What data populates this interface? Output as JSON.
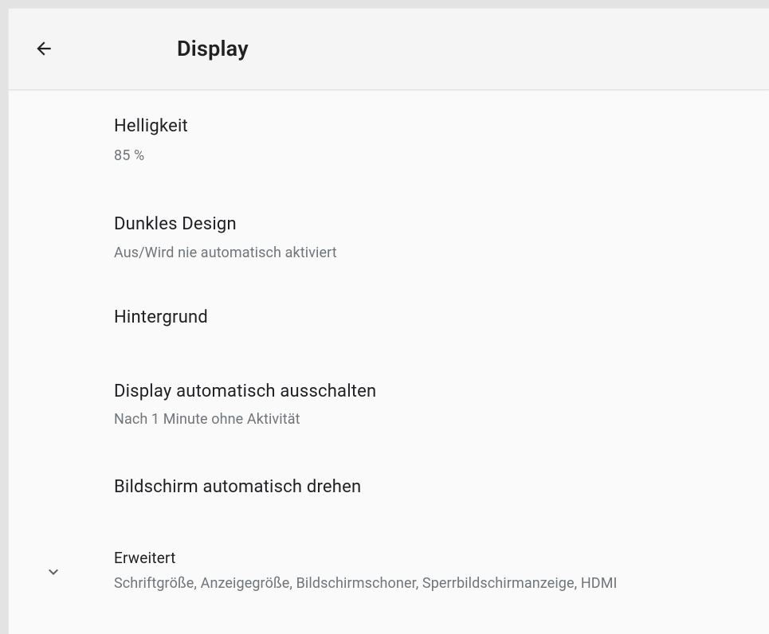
{
  "header": {
    "back_icon": "arrow-back-icon",
    "title": "Display"
  },
  "items": [
    {
      "title": "Helligkeit",
      "summary": "85 %"
    },
    {
      "title": "Dunkles Design",
      "summary": "Aus/Wird nie automatisch aktiviert"
    },
    {
      "title": "Hintergrund",
      "summary": ""
    },
    {
      "title": "Display automatisch ausschalten",
      "summary": "Nach 1 Minute ohne Aktivität"
    },
    {
      "title": "Bildschirm automatisch drehen",
      "summary": ""
    }
  ],
  "advanced": {
    "icon": "chevron-down-icon",
    "title": "Erweitert",
    "summary": "Schriftgröße, Anzeigegröße, Bildschirmschoner, Sperrbildschirmanzeige, HDMI"
  },
  "colors": {
    "background": "#fafafa",
    "appbar": "#f5f5f5",
    "primary_text": "#202124",
    "secondary_text": "#70757a"
  }
}
